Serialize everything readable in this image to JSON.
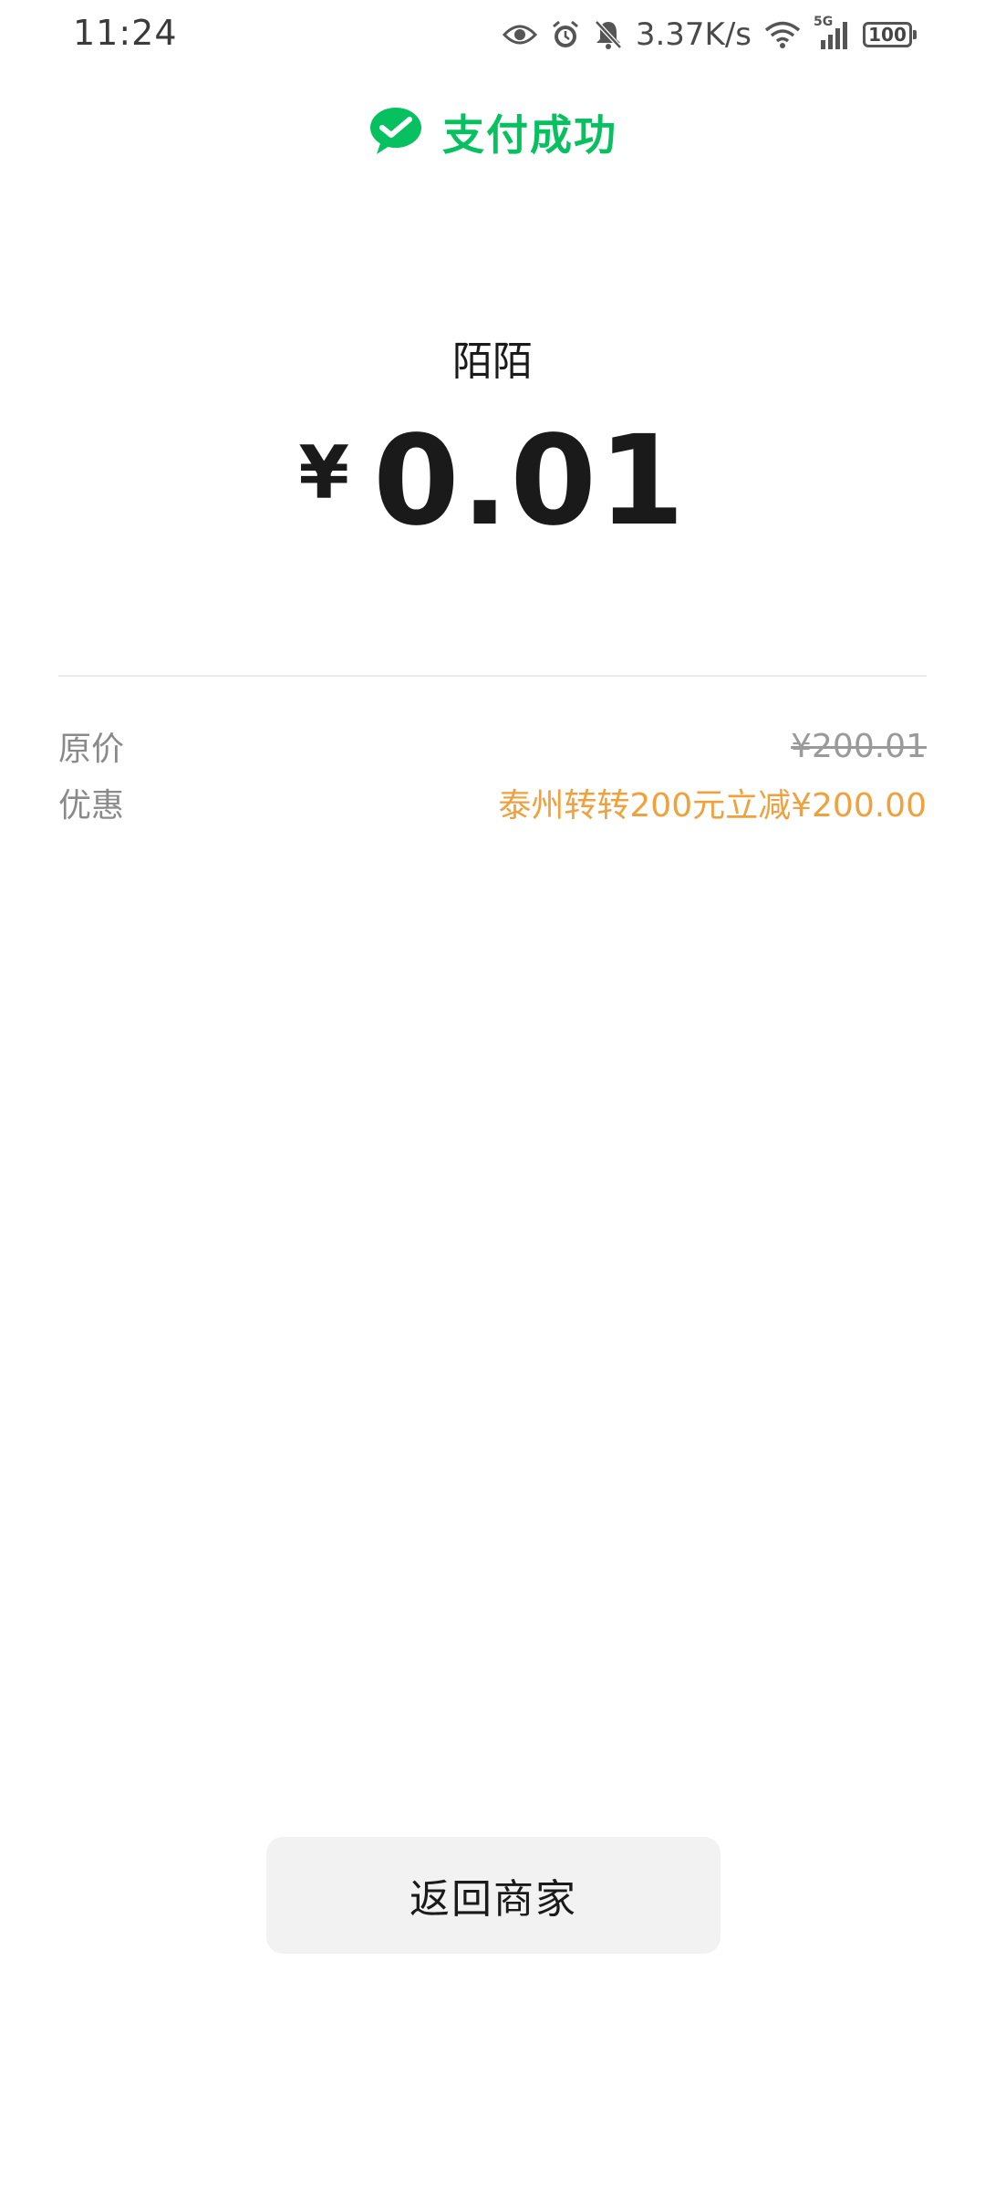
{
  "status_bar": {
    "time": "11:24",
    "net_speed": "3.37K/s",
    "battery": "100",
    "icons": [
      "eye-icon",
      "alarm-icon",
      "bell-off-icon",
      "wifi-icon",
      "signal-5g-icon",
      "battery-icon"
    ],
    "network_label": "5G"
  },
  "header": {
    "title": "支付成功",
    "icon": "wechat-pay-icon",
    "accent_color": "#07c160"
  },
  "payment": {
    "merchant": "陌陌",
    "currency": "¥",
    "amount": "0.01"
  },
  "details": {
    "original_label": "原价",
    "original_price": "¥200.01",
    "discount_label": "优惠",
    "discount_value": "泰州转转200元立减¥200.00",
    "discount_color": "#f0a03c"
  },
  "actions": {
    "back_label": "返回商家"
  }
}
